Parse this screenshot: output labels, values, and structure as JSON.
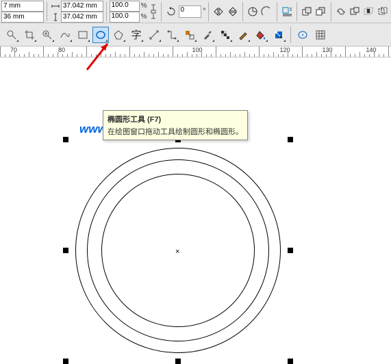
{
  "dims": {
    "w_unit": "7 mm",
    "h_unit": "36 mm",
    "w": "37.042 mm",
    "h": "37.042 mm"
  },
  "scale": {
    "x": "100.0",
    "y": "100.0",
    "unit": "%"
  },
  "rotation": "0",
  "ruler": {
    "t70": "70",
    "t80": "80",
    "t100": "100",
    "t120": "120",
    "t130": "130",
    "t140": "140"
  },
  "watermark": "www.rjzxw.com",
  "tooltip": {
    "title": "椭圆形工具 (F7)",
    "desc": "在绘图窗口拖动工具绘制圆形和椭圆形。"
  }
}
